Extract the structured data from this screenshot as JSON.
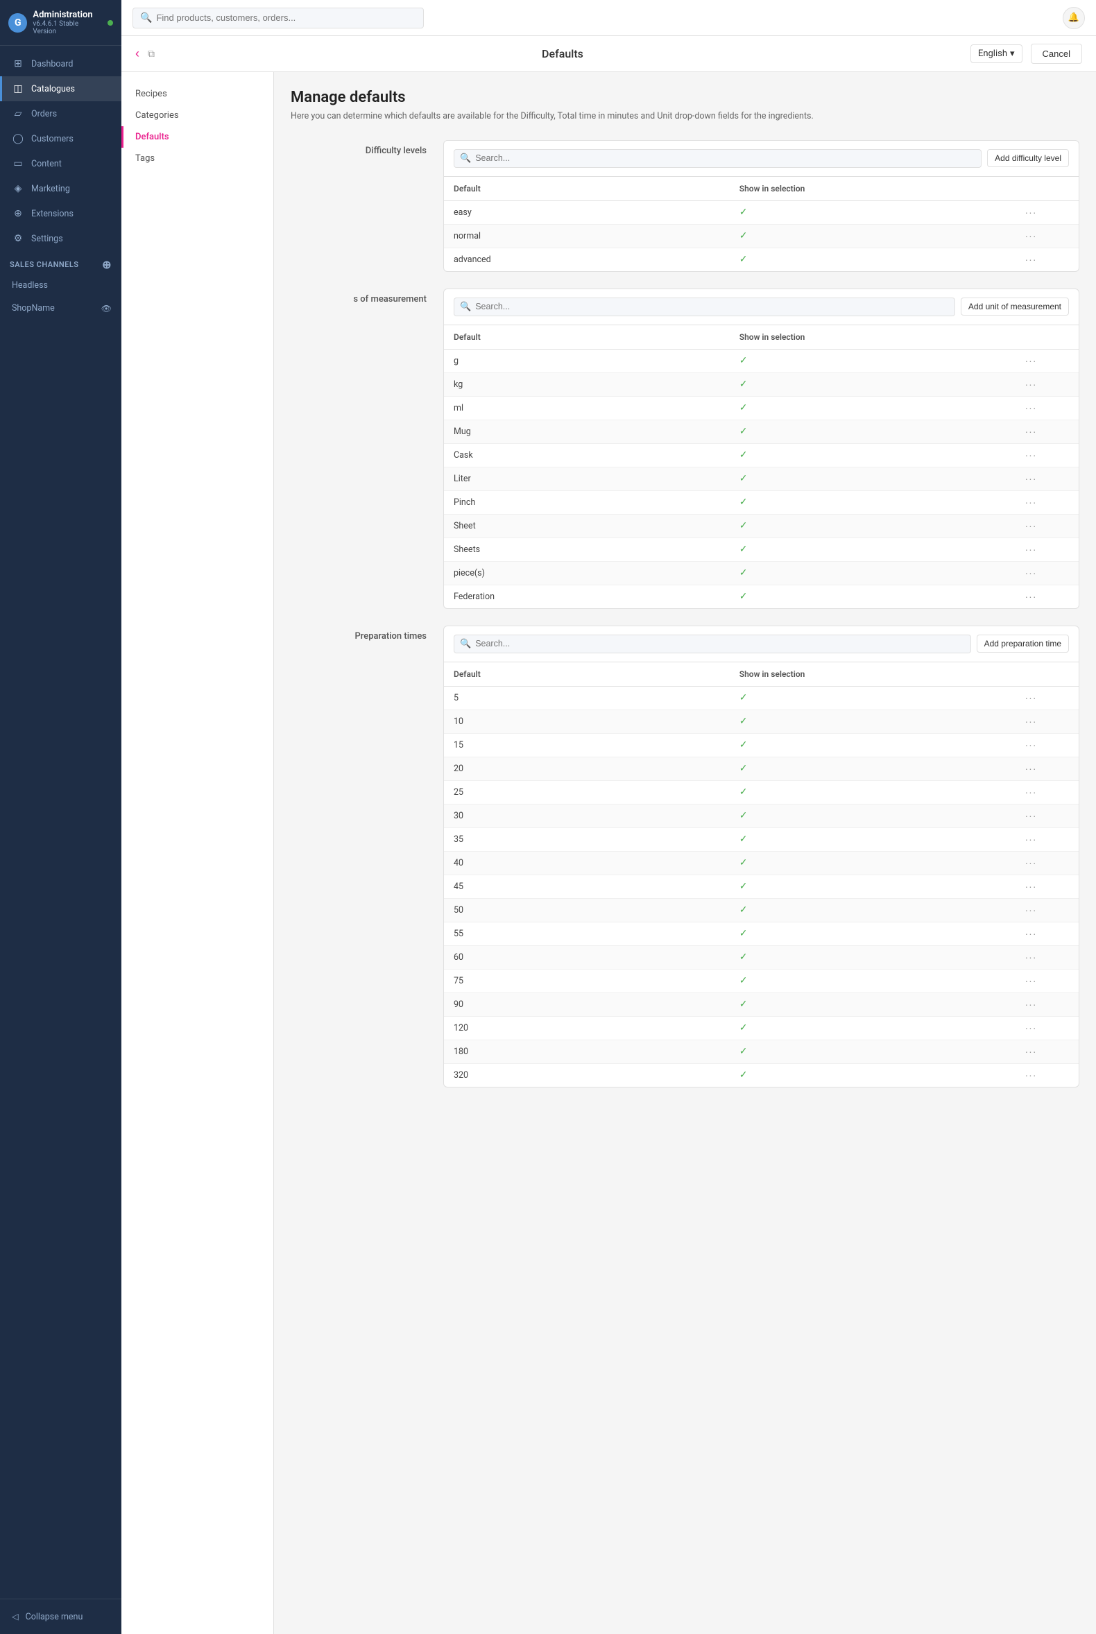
{
  "app": {
    "name": "Administration",
    "version": "v6.4.6.1 Stable Version"
  },
  "topbar": {
    "search_placeholder": "Find products, customers, orders...",
    "page_title": "Defaults"
  },
  "language": {
    "selected": "English"
  },
  "buttons": {
    "cancel": "Cancel",
    "add_difficulty": "Add difficulty level",
    "add_unit": "Add unit of measurement",
    "add_preparation": "Add preparation time"
  },
  "sidebar": {
    "nav_items": [
      {
        "id": "dashboard",
        "label": "Dashboard",
        "icon": "⊞"
      },
      {
        "id": "catalogues",
        "label": "Catalogues",
        "icon": "📋",
        "active": true
      },
      {
        "id": "orders",
        "label": "Orders",
        "icon": "📦"
      },
      {
        "id": "customers",
        "label": "Customers",
        "icon": "👤"
      },
      {
        "id": "content",
        "label": "Content",
        "icon": "📄"
      },
      {
        "id": "marketing",
        "label": "Marketing",
        "icon": "📢"
      },
      {
        "id": "extensions",
        "label": "Extensions",
        "icon": "🔧"
      },
      {
        "id": "settings",
        "label": "Settings",
        "icon": "⚙"
      }
    ],
    "sales_channels_label": "Sales Channels",
    "sales_channels": [
      {
        "id": "headless",
        "label": "Headless"
      },
      {
        "id": "shopname",
        "label": "ShopName"
      }
    ],
    "collapse_label": "Collapse menu"
  },
  "left_nav": [
    {
      "id": "recipes",
      "label": "Recipes"
    },
    {
      "id": "categories",
      "label": "Categories"
    },
    {
      "id": "defaults",
      "label": "Defaults",
      "active": true
    },
    {
      "id": "tags",
      "label": "Tags"
    }
  ],
  "manage": {
    "title": "Manage defaults",
    "description": "Here you can determine which defaults are available for the Difficulty, Total time in minutes and Unit drop-down fields for the ingredients."
  },
  "difficulty_section": {
    "label": "Difficulty levels",
    "search_placeholder": "Search...",
    "table_headers": [
      "Default",
      "Show in selection",
      ""
    ],
    "rows": [
      {
        "default": "easy",
        "show": true
      },
      {
        "default": "normal",
        "show": true
      },
      {
        "default": "advanced",
        "show": true
      }
    ]
  },
  "units_section": {
    "label": "s of measurement",
    "search_placeholder": "Search...",
    "table_headers": [
      "Default",
      "Show in selection",
      ""
    ],
    "rows": [
      {
        "default": "g",
        "show": true
      },
      {
        "default": "kg",
        "show": true
      },
      {
        "default": "ml",
        "show": true
      },
      {
        "default": "Mug",
        "show": true
      },
      {
        "default": "Cask",
        "show": true
      },
      {
        "default": "Liter",
        "show": true
      },
      {
        "default": "Pinch",
        "show": true
      },
      {
        "default": "Sheet",
        "show": true
      },
      {
        "default": "Sheets",
        "show": true
      },
      {
        "default": "piece(s)",
        "show": true
      },
      {
        "default": "Federation",
        "show": true
      }
    ]
  },
  "preparation_section": {
    "label": "Preparation times",
    "search_placeholder": "Search...",
    "table_headers": [
      "Default",
      "Show in selection",
      ""
    ],
    "rows": [
      {
        "default": "5",
        "show": true
      },
      {
        "default": "10",
        "show": true
      },
      {
        "default": "15",
        "show": true
      },
      {
        "default": "20",
        "show": true
      },
      {
        "default": "25",
        "show": true
      },
      {
        "default": "30",
        "show": true
      },
      {
        "default": "35",
        "show": true
      },
      {
        "default": "40",
        "show": true
      },
      {
        "default": "45",
        "show": true
      },
      {
        "default": "50",
        "show": true
      },
      {
        "default": "55",
        "show": true
      },
      {
        "default": "60",
        "show": true
      },
      {
        "default": "75",
        "show": true
      },
      {
        "default": "90",
        "show": true
      },
      {
        "default": "120",
        "show": true
      },
      {
        "default": "180",
        "show": true
      },
      {
        "default": "320",
        "show": true
      }
    ]
  }
}
